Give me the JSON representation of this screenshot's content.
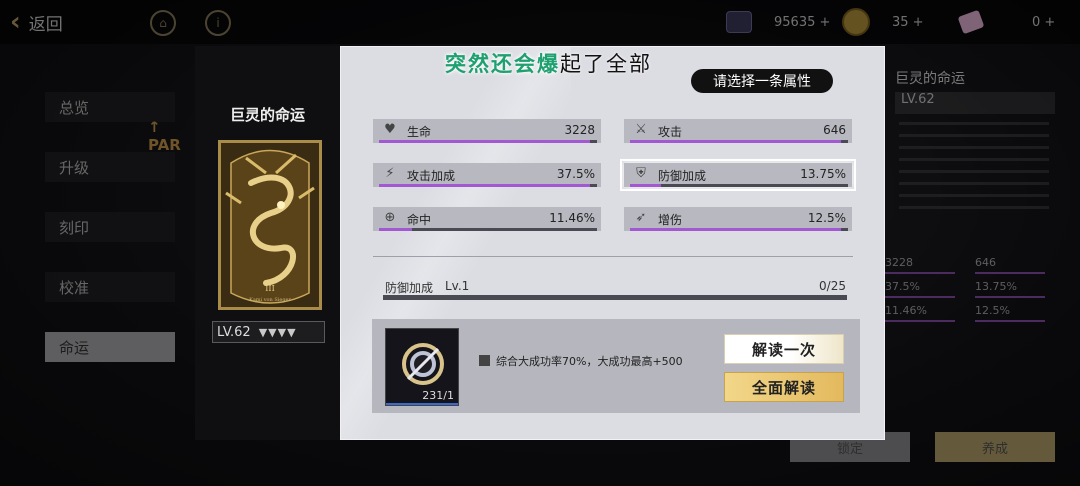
{
  "topbar": {
    "back_label": "返回",
    "resource_1": "95635 +",
    "resource_2": "35 +",
    "resource_3": "0 +"
  },
  "background_left": {
    "tag": "PAR",
    "items": [
      "总览",
      "升级",
      "刻印",
      "校准",
      "命运"
    ],
    "selected": "命运"
  },
  "background_right": {
    "title": "巨灵的命运",
    "subtitle": "LV.62",
    "stats": [
      "3228",
      "646",
      "37.5%",
      "13.75%",
      "11.46%",
      "12.5%"
    ],
    "buttons": [
      "锁定",
      "养成"
    ]
  },
  "card": {
    "title": "巨灵的命运",
    "numeral": "III",
    "caption": "Kami von Sieger",
    "level": "LV.62",
    "stars": "▼▼▼▼"
  },
  "overlay_banner": {
    "text": "突然还会爆",
    "tail": "起了全部"
  },
  "prompt": "请选择一条属性",
  "attributes": [
    {
      "name": "生命",
      "value": "3228",
      "icon": "heart-icon",
      "fill": 0.97
    },
    {
      "name": "攻击",
      "value": "646",
      "icon": "sword-icon",
      "fill": 0.97
    },
    {
      "name": "攻击加成",
      "value": "37.5%",
      "icon": "attack-boost-icon",
      "fill": 0.97
    },
    {
      "name": "防御加成",
      "value": "13.75%",
      "icon": "shield-icon",
      "fill": 0.14
    },
    {
      "name": "命中",
      "value": "11.46%",
      "icon": "crosshair-icon",
      "fill": 0.15
    },
    {
      "name": "增伤",
      "value": "12.5%",
      "icon": "damage-up-icon",
      "fill": 0.97
    }
  ],
  "selected_attribute": "防御加成",
  "progress": {
    "label": "防御加成",
    "level": "Lv.1",
    "count": "0/25",
    "fill": 0.0
  },
  "item": {
    "count": "231/1",
    "icon": "decode-token-icon"
  },
  "rate_text": "综合大成功率70%，大成功最高+500",
  "buttons": {
    "decode_once": "解读一次",
    "decode_all": "全面解读"
  },
  "colors": {
    "accent_purple": "#a258d0",
    "panel_bg": "#dcdde3",
    "gold": "#e3b95e"
  }
}
